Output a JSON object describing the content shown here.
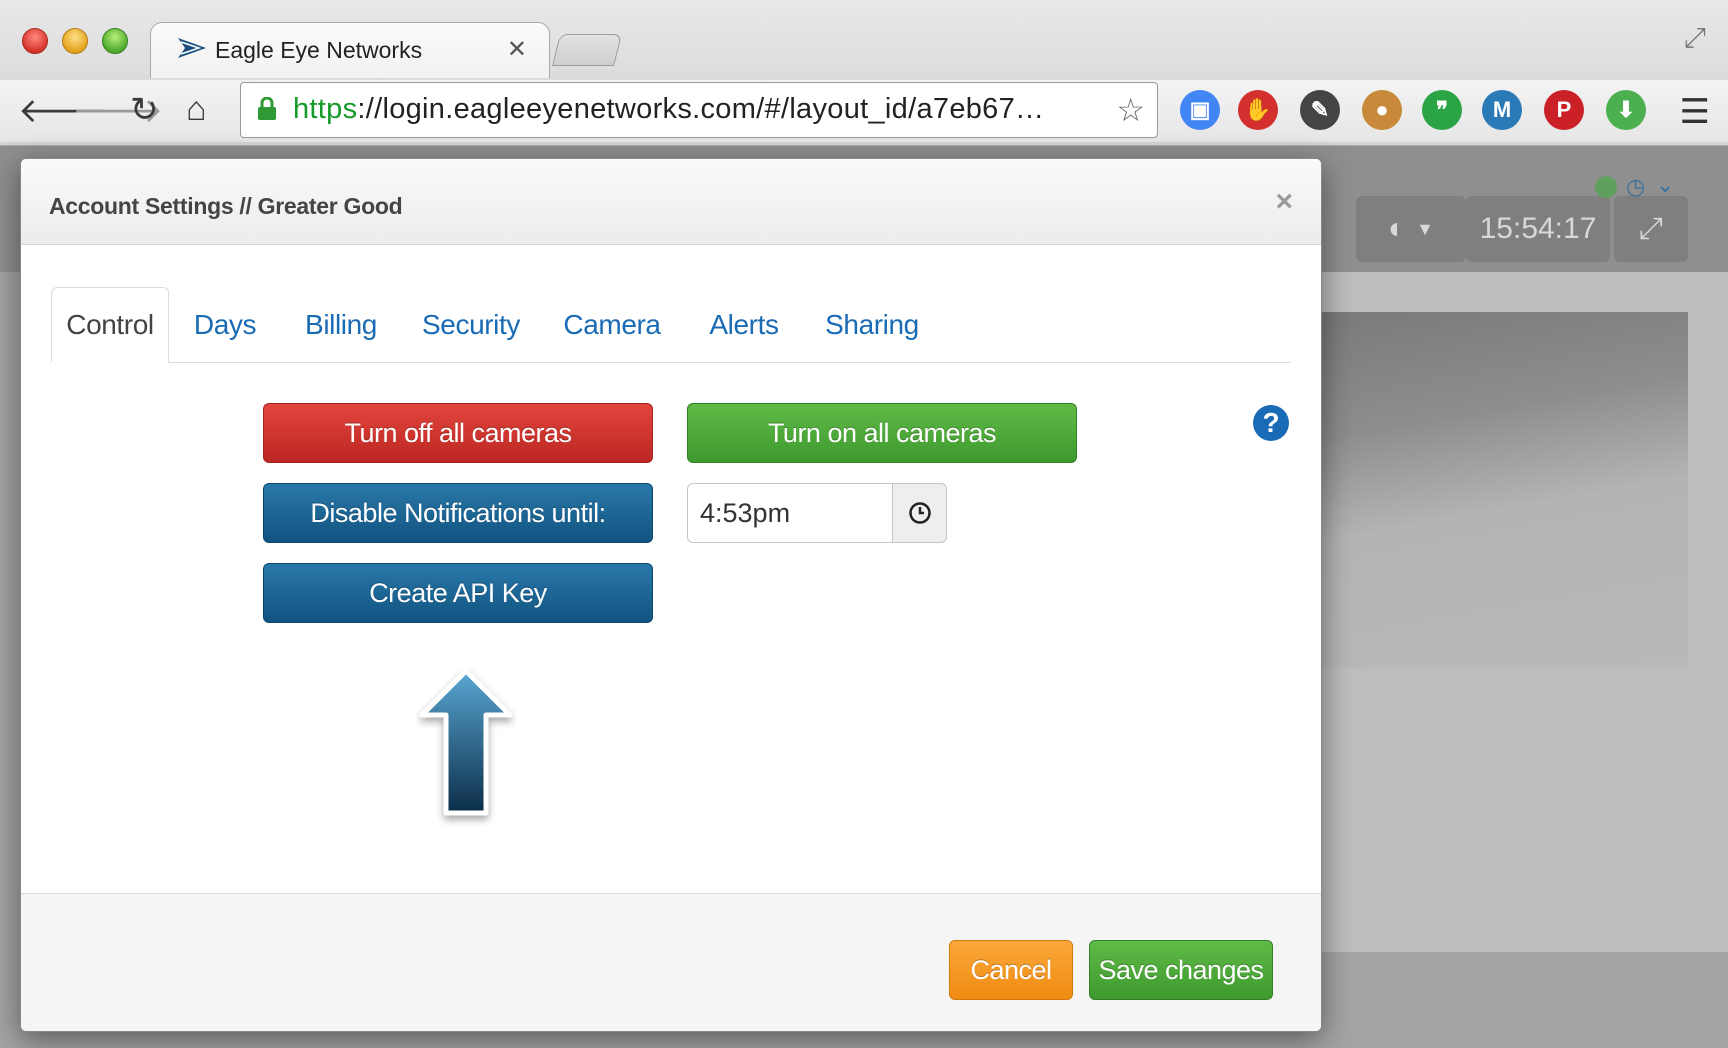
{
  "browser": {
    "tab_title": "Eagle Eye Networks",
    "url_scheme": "https",
    "url_rest": "://login.eagleeyenetworks.com/#/layout_id/a7eb67…",
    "extensions": [
      {
        "name": "google-cast-icon",
        "color": "#4285f4"
      },
      {
        "name": "stop-hand-icon",
        "color": "#d32f2f"
      },
      {
        "name": "wrench-icon",
        "color": "#444444"
      },
      {
        "name": "cookie-icon",
        "color": "#c8893a"
      },
      {
        "name": "hangouts-icon",
        "color": "#2aa444"
      },
      {
        "name": "m-cloud-icon",
        "color": "#2a7ab8"
      },
      {
        "name": "pinterest-icon",
        "color": "#cb2027"
      },
      {
        "name": "download-icon",
        "color": "#4caf50"
      }
    ]
  },
  "background_app": {
    "clock": "15:54:17"
  },
  "modal": {
    "title": "Account Settings // Greater Good",
    "close": "×",
    "tabs": [
      {
        "label": "Control",
        "active": true
      },
      {
        "label": "Days"
      },
      {
        "label": "Billing"
      },
      {
        "label": "Security"
      },
      {
        "label": "Camera"
      },
      {
        "label": "Alerts"
      },
      {
        "label": "Sharing"
      }
    ],
    "control": {
      "turn_off_label": "Turn off all cameras",
      "turn_on_label": "Turn on all cameras",
      "disable_notifications_label": "Disable Notifications until:",
      "notification_time": "4:53pm",
      "create_api_key_label": "Create API Key"
    },
    "footer": {
      "cancel_label": "Cancel",
      "save_label": "Save changes"
    }
  },
  "colors": {
    "link_blue": "#1a6bb5",
    "danger": "#c9302c",
    "success": "#4cae3b",
    "primary": "#1a5f8f",
    "warning": "#f0961a"
  }
}
